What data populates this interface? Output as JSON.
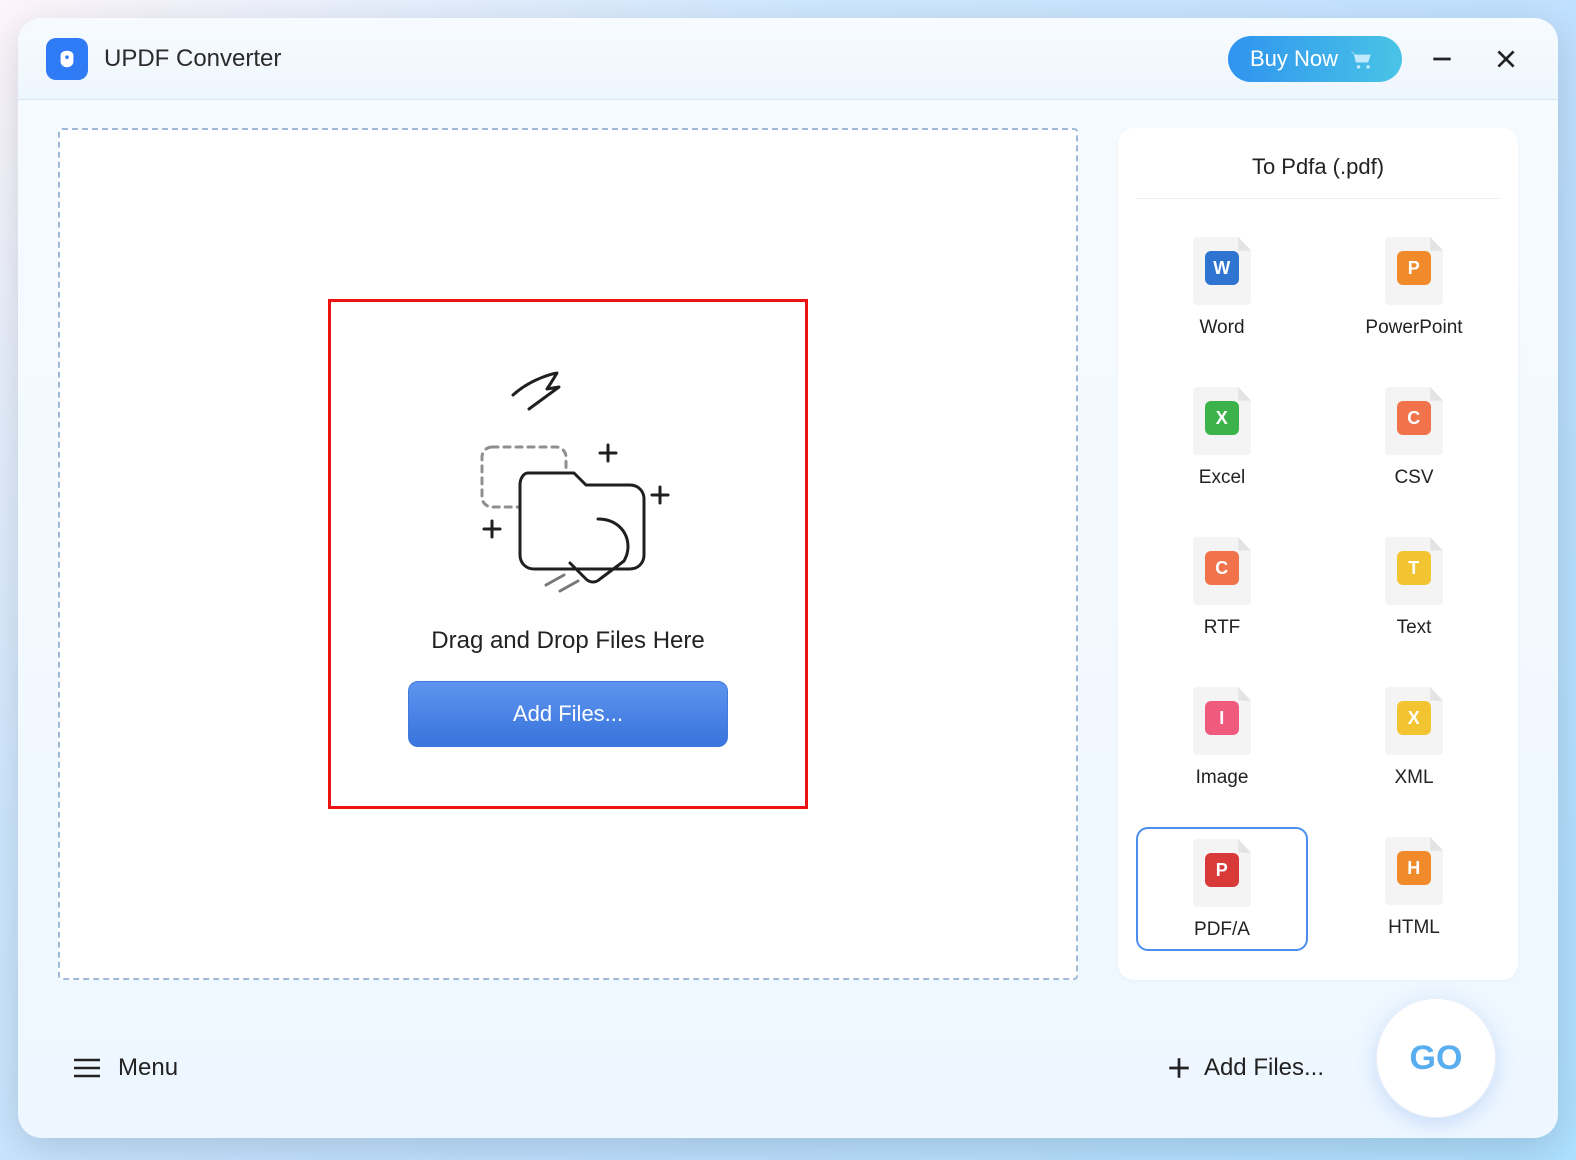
{
  "titlebar": {
    "app_name": "UPDF Converter",
    "buy_now_label": "Buy Now"
  },
  "dropzone": {
    "hint": "Drag and Drop Files Here",
    "add_files_label": "Add Files..."
  },
  "panel": {
    "title": "To Pdfa (.pdf)",
    "formats": [
      {
        "label": "Word",
        "badge": "W",
        "color": "#2f74d0"
      },
      {
        "label": "PowerPoint",
        "badge": "P",
        "color": "#f08a2b"
      },
      {
        "label": "Excel",
        "badge": "X",
        "color": "#3cb24a"
      },
      {
        "label": "CSV",
        "badge": "C",
        "color": "#f0734b"
      },
      {
        "label": "RTF",
        "badge": "C",
        "color": "#f0734b"
      },
      {
        "label": "Text",
        "badge": "T",
        "color": "#f2c431"
      },
      {
        "label": "Image",
        "badge": "I",
        "color": "#f05a7d"
      },
      {
        "label": "XML",
        "badge": "X",
        "color": "#f2c431"
      },
      {
        "label": "PDF/A",
        "badge": "P",
        "color": "#d83a3a"
      },
      {
        "label": "HTML",
        "badge": "H",
        "color": "#f08a2b"
      }
    ],
    "selected_index": 8
  },
  "footer": {
    "menu_label": "Menu",
    "add_files_label": "Add Files...",
    "go_label": "GO"
  }
}
